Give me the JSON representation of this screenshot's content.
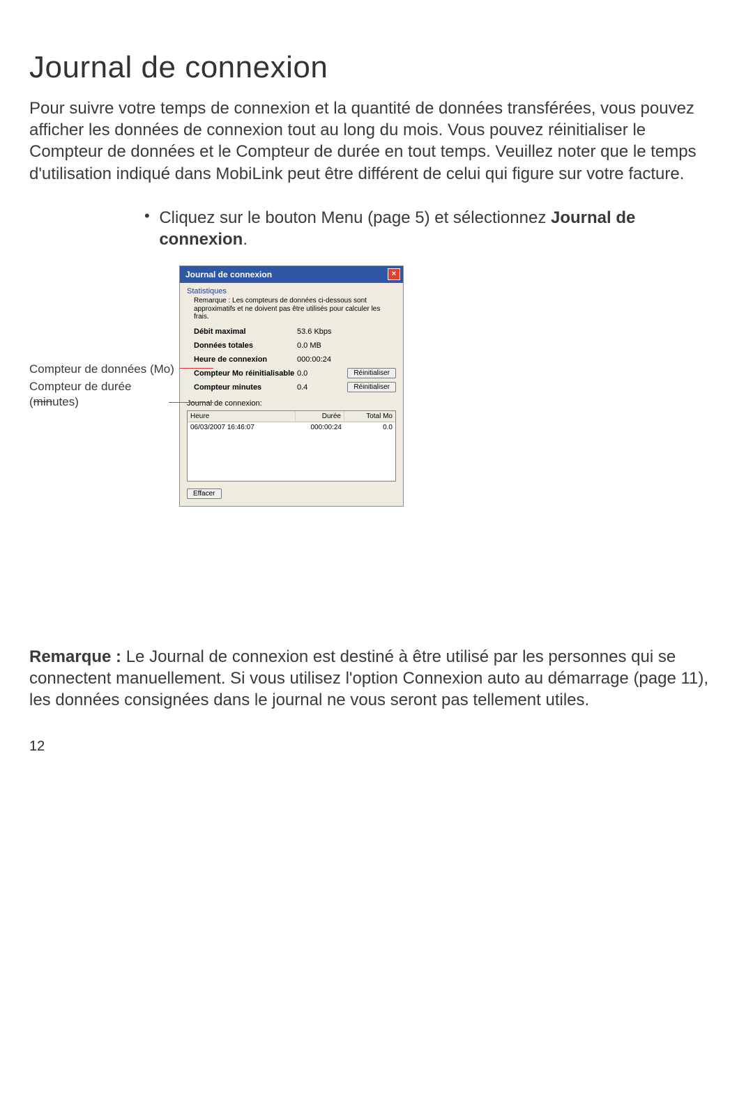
{
  "heading": "Journal de connexion",
  "intro": "Pour suivre votre temps de connexion et la quantité de données transférées, vous pouvez afficher les données de connexion tout au long du mois. Vous pouvez réinitialiser le Compteur de données et le Compteur de durée en tout temps. Veuillez noter que le temps d'utilisation indiqué dans MobiLink peut être différent de celui qui figure sur votre facture.",
  "bullet": {
    "pre": "Cliquez sur le bouton Menu (page 5) et sélectionnez ",
    "bold": "Journal de connexion",
    "post": "."
  },
  "callouts": {
    "data": "Compteur de données (Mo)",
    "duration_pre": "Compteur de durée (",
    "duration_strike": "min",
    "duration_post": "utes)"
  },
  "dialog": {
    "title": "Journal de connexion",
    "stats_legend": "Statistiques",
    "note": "Remarque : Les compteurs de données ci-dessous sont approximatifs et ne doivent pas être utilisés pour calculer les frais.",
    "rows": {
      "r0": {
        "label": "Débit maximal",
        "value": "53.6 Kbps"
      },
      "r1": {
        "label": "Données totales",
        "value": "0.0 MB"
      },
      "r2": {
        "label": "Heure de connexion",
        "value": "000:00:24"
      },
      "r3": {
        "label": "Compteur Mo réinitialisable",
        "value": "0.0"
      },
      "r4": {
        "label": "Compteur minutes",
        "value": "0.4"
      }
    },
    "reset_button": "Réinitialiser",
    "log_label": "Journal de connexion:",
    "log_headers": {
      "time": "Heure",
      "duration": "Durée",
      "total": "Total Mo"
    },
    "log_row": {
      "time": "06/03/2007 16:46:07",
      "duration": "000:00:24",
      "total": "0.0"
    },
    "clear_button": "Effacer"
  },
  "remarque": {
    "label": "Remarque : ",
    "text": "Le Journal de connexion est destiné à être utilisé par les personnes qui se connectent manuellement. Si vous utilisez l'option Connexion auto au démarrage (page 11), les données consignées dans le journal ne vous seront pas tellement utiles."
  },
  "page_number": "12"
}
